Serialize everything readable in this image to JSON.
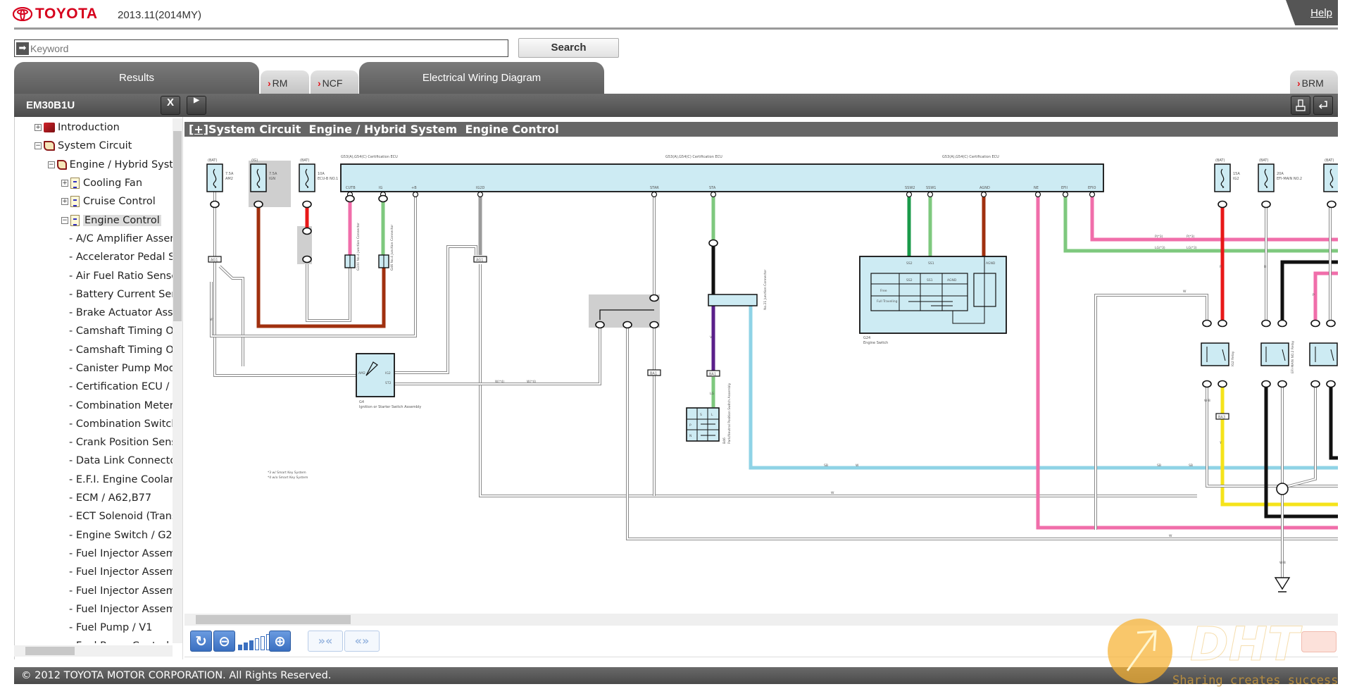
{
  "header": {
    "brand": "TOYOTA",
    "version": "2013.11(2014MY)",
    "help_label": "Help"
  },
  "search": {
    "placeholder": "Keyword",
    "value": "",
    "button_label": "Search"
  },
  "tabs": {
    "results": "Results",
    "rm": "RM",
    "ncf": "NCF",
    "ewd": "Electrical Wiring Diagram",
    "brm": "BRM"
  },
  "toolbar": {
    "doc_id": "EM30B1U",
    "close_label": "X",
    "expand_label": "▶",
    "print_icon": "print-icon",
    "back_icon": "return-icon"
  },
  "tree": {
    "nodes": [
      {
        "label": "Introduction",
        "level": 0,
        "state": "collapsed"
      },
      {
        "label": "System Circuit",
        "level": 0,
        "state": "expanded"
      },
      {
        "label": "Engine / Hybrid Syst",
        "level": 1,
        "state": "expanded"
      },
      {
        "label": "Cooling Fan",
        "level": 2,
        "state": "collapsed"
      },
      {
        "label": "Cruise Control",
        "level": 2,
        "state": "collapsed"
      },
      {
        "label": "Engine Control",
        "level": 2,
        "state": "expanded",
        "selected": true
      }
    ],
    "leaves": [
      "- A/C Amplifier Assem",
      "- Accelerator Pedal Se",
      "- Air Fuel Ratio Senso",
      "- Battery Current Sen",
      "- Brake Actuator Asse",
      "- Camshaft Timing Oi",
      "- Camshaft Timing Oi",
      "- Canister Pump Mod",
      "- Certification ECU / (",
      "- Combination Meter",
      "- Combination Switch",
      "- Crank Position Sens",
      "- Data Link Connecto",
      "- E.F.I. Engine Coolar",
      "- ECM / A62,B77",
      "- ECT Solenoid (Trans",
      "- Engine Switch / G24",
      "- Fuel Injector Assem",
      "- Fuel Injector Assem",
      "- Fuel Injector Assem",
      "- Fuel Injector Assem",
      "- Fuel Pump / V1",
      "- Fuel Pump Control"
    ]
  },
  "title": {
    "expand": "[+]",
    "text": "System Circuit  Engine / Hybrid System  Engine Control"
  },
  "diagram": {
    "fuses": [
      {
        "source": "(BAT)",
        "rating": "7.5A",
        "name": "AM2"
      },
      {
        "source": "(IG)",
        "rating": "7.5A",
        "name": "IGN"
      },
      {
        "source": "(BAT)",
        "rating": "10A",
        "name": "ECU-B NO.1"
      },
      {
        "source": "(BAT)",
        "rating": "15A",
        "name": "IG2"
      },
      {
        "source": "(BAT)",
        "rating": "20A",
        "name": "EFI-MAIN NO.2"
      },
      {
        "source": "(BAT)",
        "rating": "",
        "name": ""
      }
    ],
    "ecu_label": "G53(A),G54(C) Certification ECU",
    "ecu_pins": [
      "CUTB",
      "IG",
      "+B",
      "IG2D",
      "STAR",
      "STA",
      "SSW2",
      "SSW1",
      "AGND",
      "NE",
      "EFII",
      "EFIO"
    ],
    "junction_connectors": [
      "G100 No.4 Junction Connector",
      "G46 No.4 Junction Connector",
      "No.21 Junction Connector"
    ],
    "connector_ids": [
      "AG1",
      "AG1",
      "BA1",
      "BA1",
      "BA3"
    ],
    "ignition_switch": {
      "id": "G4",
      "name": "Ignition or Starter Switch Assembly",
      "pins": [
        "AM2",
        "IG2",
        "ST2"
      ]
    },
    "engine_switch": {
      "id": "G24",
      "name": "Engine Switch",
      "columns": [
        "SS2",
        "SS1",
        "AGND"
      ],
      "rows": [
        "Free",
        "Full Traveling"
      ]
    },
    "park_neutral_switch": {
      "id": "B46",
      "name": "Park/Neutral Position Switch Assembly",
      "columns": [
        "S",
        "L"
      ],
      "rows": [
        "P",
        "N"
      ]
    },
    "relays": [
      "IG2 Relay",
      "EFI-MAIN NO.2 Relay"
    ],
    "wire_labels": [
      "W",
      "SB",
      "W",
      "LG",
      "V",
      "SB",
      "SB",
      "P(*3)",
      "P(*3)",
      "LG(*3)",
      "LG(*3)",
      "W",
      "W",
      "W",
      "W(*4)",
      "W(*4)",
      "R",
      "Y",
      "B",
      "P",
      "W-B",
      "W-B"
    ],
    "footnotes": [
      "*3 w/ Smart Key System",
      "*4 w/o Smart Key System"
    ]
  },
  "viewer": {
    "zoom_level": 3,
    "zoom_steps": 6,
    "reset_icon": "refresh-icon",
    "zoom_out_icon": "zoom-out-icon",
    "zoom_in_icon": "zoom-in-icon",
    "fit_icon": "fit-width-icon",
    "expand_icon": "expand-width-icon"
  },
  "footer": {
    "copyright": "© 2012 TOYOTA MOTOR CORPORATION. All Rights Reserved."
  },
  "watermark": {
    "logo": "DHT",
    "slogan": "Sharing creates success"
  },
  "colors": {
    "brand": "#d6001c",
    "toolbar": "#5c5c5c",
    "component_fill": "#cdebf3",
    "zoom_button": "#3a6fc0"
  }
}
